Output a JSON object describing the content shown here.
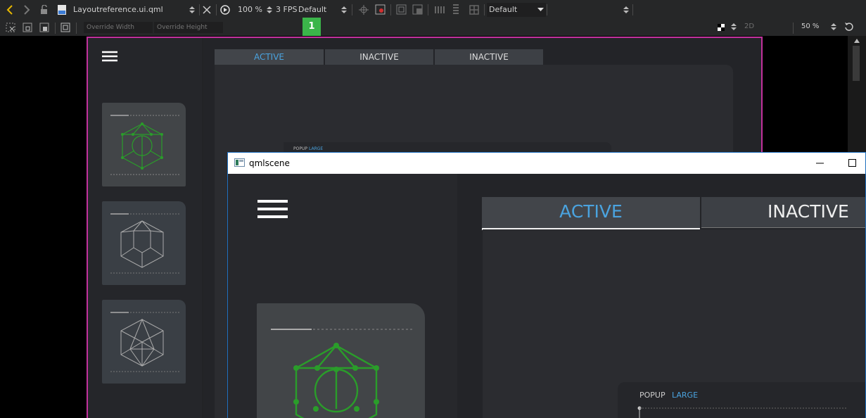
{
  "toolbar": {
    "file_name": "Layoutreference.ui.qml",
    "zoom": "100 %",
    "fps": "3 FPS",
    "animation_mode": "Default",
    "theme": "Default",
    "override_width_placeholder": "Override Width",
    "override_height_placeholder": "Override Height",
    "badge": "1",
    "mode_2d": "2D",
    "zoom_right": "50 %"
  },
  "design": {
    "tabs": [
      "ACTIVE",
      "INACTIVE",
      "INACTIVE"
    ],
    "popup_label": "POPUP",
    "popup_size": "LARGE"
  },
  "qmlscene": {
    "title": "qmlscene",
    "tabs": [
      "ACTIVE",
      "INACTIVE"
    ],
    "popup_label": "POPUP",
    "popup_size": "LARGE"
  },
  "colors": {
    "accent_blue": "#4aa3df",
    "green": "#2a9d2a",
    "frame_pink": "#c2319d"
  }
}
